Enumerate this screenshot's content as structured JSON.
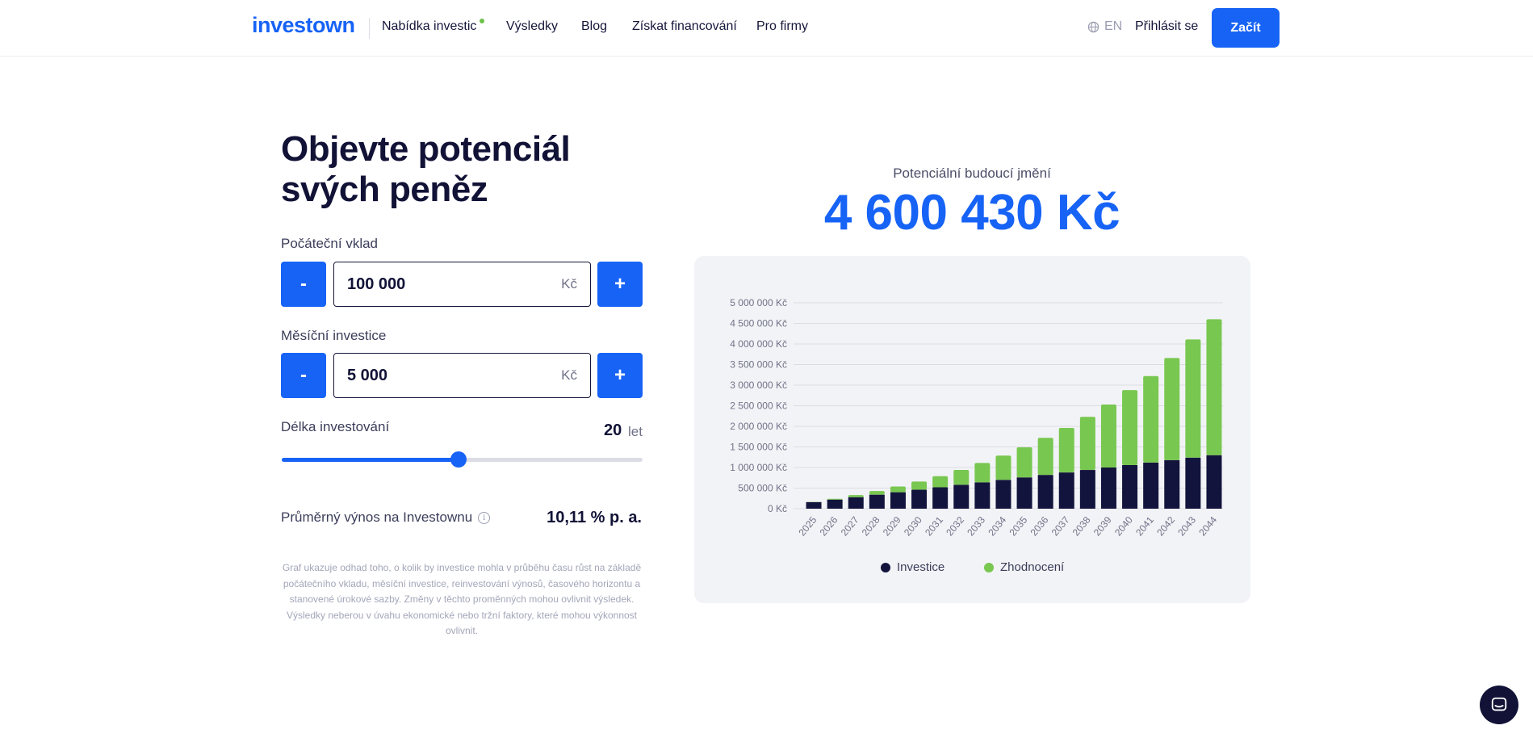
{
  "header": {
    "logo": "investown",
    "nav": [
      "Nabídka investic",
      "Výsledky",
      "Blog",
      "Získat financování",
      "Pro firmy"
    ],
    "language": "EN",
    "login": "Přihlásit se",
    "start_button": "Začít",
    "colors": {
      "accent": "#1763f6",
      "new_dot": "#6cc24a"
    }
  },
  "calculator": {
    "headline_line1": "Objevte potenciál",
    "headline_line2": "svých peněz",
    "initial_deposit": {
      "label": "Počáteční vklad",
      "value": "100 000",
      "unit": "Kč",
      "minus": "-",
      "plus": "+"
    },
    "monthly_investment": {
      "label": "Měsíční investice",
      "value": "5 000",
      "unit": "Kč",
      "minus": "-",
      "plus": "+"
    },
    "duration": {
      "label": "Délka investování",
      "value": "20",
      "unit": "let",
      "slider_fraction": 0.49
    },
    "avg_yield": {
      "label": "Průměrný výnos na Investownu",
      "value": "10,11 % p. a."
    },
    "disclaimer": "Graf ukazuje odhad toho, o kolik by investice mohla v průběhu času růst na základě počátečního vkladu, měsíční investice, reinvestování výnosů, časového horizontu a stanovené úrokové sazby. Změny v těchto proměnných mohou ovlivnit výsledek. Výsledky neberou v úvahu ekonomické nebo tržní faktory, které mohou výkonnost ovlivnit."
  },
  "result": {
    "label": "Potenciální budoucí jmění",
    "value": "4 600 430 Kč"
  },
  "chart_data": {
    "type": "bar",
    "stacked": true,
    "categories": [
      "2025",
      "2026",
      "2027",
      "2028",
      "2029",
      "2030",
      "2031",
      "2032",
      "2033",
      "2034",
      "2035",
      "2036",
      "2037",
      "2038",
      "2039",
      "2040",
      "2041",
      "2042",
      "2043",
      "2044"
    ],
    "series": [
      {
        "name": "Investice",
        "color": "#13143d",
        "values": [
          160000,
          220000,
          280000,
          340000,
          400000,
          460000,
          520000,
          580000,
          640000,
          700000,
          760000,
          820000,
          880000,
          940000,
          1000000,
          1060000,
          1120000,
          1180000,
          1240000,
          1300000
        ]
      },
      {
        "name": "Zhodnocení",
        "color": "#78c750",
        "values": [
          5000,
          20000,
          50000,
          90000,
          140000,
          200000,
          270000,
          360000,
          470000,
          590000,
          730000,
          900000,
          1080000,
          1290000,
          1530000,
          1820000,
          2100000,
          2480000,
          2870000,
          3300000
        ]
      }
    ],
    "yticks": [
      "0 Kč",
      "500 000 Kč",
      "1 000 000 Kč",
      "1 500 000 Kč",
      "2 000 000 Kč",
      "2 500 000 Kč",
      "3 000 000 Kč",
      "3 500 000 Kč",
      "4 000 000 Kč",
      "4 500 000 Kč",
      "5 000 000 Kč"
    ],
    "ylim": [
      0,
      5000000
    ],
    "grid": true,
    "legend": "bottom"
  },
  "chat": {
    "icon": "chat-icon"
  }
}
